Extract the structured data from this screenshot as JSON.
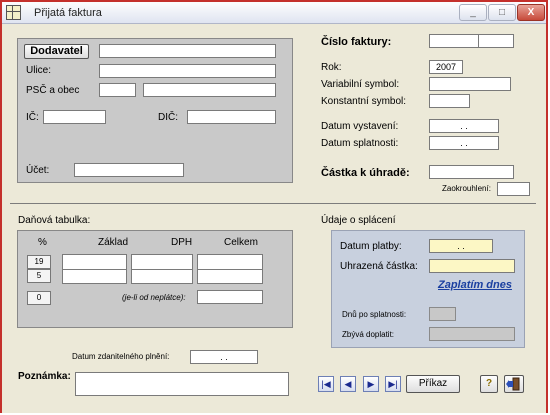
{
  "window": {
    "title": "Přijatá faktura",
    "buttons": [
      "_",
      "□",
      "X"
    ]
  },
  "supplier": {
    "button": "Dodavatel",
    "street": "Ulice:",
    "zip_city": "PSČ a obec",
    "ic": "IČ:",
    "dic": "DIČ:",
    "account": "Účet:"
  },
  "invoice": {
    "number_label": "Číslo faktury:",
    "year_label": "Rok:",
    "year_value": "2007",
    "variable_symbol": "Variabilní symbol:",
    "constant_symbol": "Konstantní symbol:",
    "issue_date": "Datum vystavení:",
    "issue_date_value": ". .",
    "due_date": "Datum splatnosti:",
    "due_date_value": ". .",
    "amount_due": "Částka k úhradě:",
    "rounding": "Zaokrouhlení:"
  },
  "tax": {
    "title": "Daňová tabulka:",
    "headers": [
      "%",
      "Základ",
      "DPH",
      "Celkem"
    ],
    "rates": [
      "19",
      "5",
      "0"
    ],
    "note": "(je-li od neplátce):"
  },
  "payment": {
    "title": "Údaje o splácení",
    "date_label": "Datum platby:",
    "date_value": ". .",
    "paid_label": "Uhrazená částka:",
    "pay_today": "Zaplatím dnes",
    "days_after": "Dnů po splatnosti:",
    "remaining": "Zbývá doplatit:"
  },
  "bottom": {
    "taxable_date": "Datum zdanitelného plnění:",
    "taxable_date_value": ". .",
    "note": "Poznámka:",
    "order_button": "Příkaz",
    "nav": [
      "|◀",
      "◀",
      "▶",
      "▶|"
    ],
    "help": "?"
  }
}
